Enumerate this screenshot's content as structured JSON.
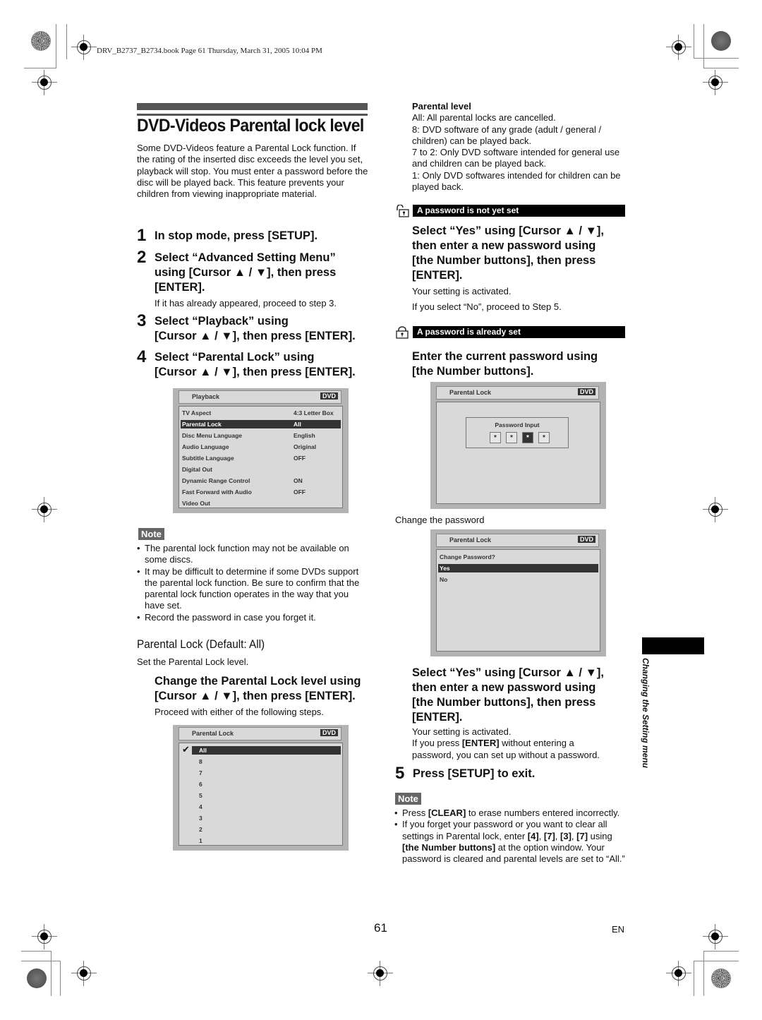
{
  "header": {
    "book_line": "DRV_B2737_B2734.book  Page 61  Thursday, March 31, 2005  10:04 PM"
  },
  "left": {
    "title": "DVD-Videos Parental lock level",
    "intro": "Some DVD-Videos feature a Parental Lock function. If the rating of the inserted disc exceeds the level you set, playback will stop. You must enter a password before the disc will be played back. This feature prevents your children from viewing inappropriate material.",
    "steps": [
      {
        "num": "1",
        "lines": [
          "In stop mode, press [SETUP]."
        ]
      },
      {
        "num": "2",
        "lines": [
          "Select “Advanced Setting Menu”",
          "using [Cursor ▲ / ▼], then press",
          "[ENTER]."
        ],
        "sub": "If it has already appeared, proceed to step 3."
      },
      {
        "num": "3",
        "lines": [
          "Select “Playback” using",
          "[Cursor ▲ / ▼], then press [ENTER]."
        ]
      },
      {
        "num": "4",
        "lines": [
          "Select “Parental Lock” using",
          "[Cursor ▲ / ▼], then press [ENTER]."
        ]
      }
    ],
    "playback_screen": {
      "title": "Playback",
      "badge": "DVD",
      "rows": [
        {
          "label": "TV Aspect",
          "value": "4:3 Letter Box",
          "selected": false
        },
        {
          "label": "Parental Lock",
          "value": "All",
          "selected": true
        },
        {
          "label": "Disc Menu Language",
          "value": "English",
          "selected": false
        },
        {
          "label": "Audio Language",
          "value": "Original",
          "selected": false
        },
        {
          "label": "Subtitle Language",
          "value": "OFF",
          "selected": false
        },
        {
          "label": "Digital Out",
          "value": "",
          "selected": false
        },
        {
          "label": "Dynamic Range Control",
          "value": "ON",
          "selected": false
        },
        {
          "label": "Fast Forward with Audio",
          "value": "OFF",
          "selected": false
        },
        {
          "label": "Video Out",
          "value": "",
          "selected": false
        }
      ]
    },
    "note": {
      "tag": "Note",
      "bullets": [
        "The parental lock function may not be available on some discs.",
        "It may be difficult to determine if some DVDs support the parental lock function. Be sure to confirm that the parental lock function operates in the way that you have set.",
        "Record the password in case you forget it."
      ]
    },
    "section": {
      "heading": "Parental Lock (Default: All)",
      "desc": "Set the Parental Lock level.",
      "instruction": [
        "Change the Parental Lock level using",
        "[Cursor ▲ / ▼], then press [ENTER]."
      ],
      "instruction_sub": "Proceed with either of the following steps."
    },
    "level_screen": {
      "title": "Parental Lock",
      "badge": "DVD",
      "options": [
        "All",
        "8",
        "7",
        "6",
        "5",
        "4",
        "3",
        "2",
        "1"
      ],
      "selected": "All",
      "check_icon": "✔"
    }
  },
  "right": {
    "parental_level": {
      "heading": "Parental level",
      "lines": [
        "All: All parental locks are cancelled.",
        "8: DVD software of any grade (adult / general / children) can be played back.",
        "7 to 2: Only DVD software intended for general use and children can be played back.",
        "1: Only DVD softwares intended for children can be played back."
      ]
    },
    "not_set": {
      "bar": "A password is not yet set",
      "instruction": [
        "Select “Yes” using [Cursor ▲ / ▼],",
        "then enter a new password using",
        "[the Number buttons], then press",
        "[ENTER]."
      ],
      "sub1": "Your setting is activated.",
      "sub2": "If you select “No”, proceed to Step 5."
    },
    "already_set": {
      "bar": "A password is already set",
      "instruction": [
        "Enter the current password using",
        "[the Number buttons]."
      ]
    },
    "password_screen": {
      "title": "Parental Lock",
      "badge": "DVD",
      "box_label": "Password Input",
      "digits": [
        "*",
        "*",
        "*",
        "*"
      ],
      "active_digit": 3
    },
    "change_caption": "Change the password",
    "change_screen": {
      "title": "Parental Lock",
      "badge": "DVD",
      "question": "Change Password?",
      "options": [
        "Yes",
        "No"
      ],
      "selected": "Yes"
    },
    "new_pw": {
      "instruction": [
        "Select “Yes” using [Cursor ▲ / ▼],",
        "then enter a new password using",
        "[the Number buttons], then press",
        "[ENTER]."
      ],
      "sub1": "Your setting is activated.",
      "sub2_pre": "If you press ",
      "sub2_bold": "[ENTER]",
      "sub2_post": " without entering a password, you can set up without a password."
    },
    "step5": {
      "num": "5",
      "text": "Press [SETUP] to exit."
    },
    "note": {
      "tag": "Note",
      "b1_pre": "Press ",
      "b1_bold": "[CLEAR]",
      "b1_post": " to erase numbers entered incorrectly.",
      "b2_pre": "If you forget your password or you want to clear all settings in Parental lock, enter ",
      "b2_k1": "[4]",
      "b2_k2": "[7]",
      "b2_k3": "[3]",
      "b2_k4": "[7]",
      "b2_mid": " using ",
      "b2_bold2": "[the Number buttons]",
      "b2_post": " at the option window. Your password is cleared and parental levels are set to “All.”"
    }
  },
  "side_tab": {
    "label": "Changing the Setting menu"
  },
  "footer": {
    "page_number": "61",
    "language": "EN"
  }
}
